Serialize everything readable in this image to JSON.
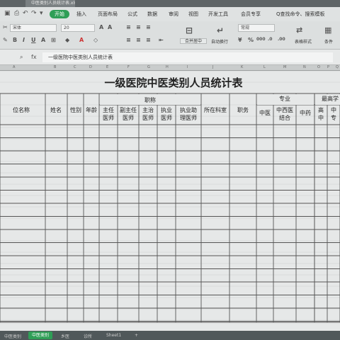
{
  "window": {
    "doc_tab": "中医类别人员统计表.xlsx"
  },
  "menu": {
    "active_tab": "开始",
    "items": [
      "插入",
      "页面布局",
      "公式",
      "数据",
      "审阅",
      "视图",
      "开发工具",
      "会员专享"
    ],
    "search": "Q查找命令、搜索模板"
  },
  "ribbon": {
    "font_name": "宋体",
    "font_size": "20",
    "number_format": "常规",
    "merge_label": "合并居中",
    "wrap_label": "自动换行",
    "format_label": "表格样式",
    "cond_label": "条件"
  },
  "formula_bar": {
    "fx": "fx",
    "formula": "一级医院中医类别人员统计表"
  },
  "columns": [
    "A",
    "B",
    "C",
    "D",
    "E",
    "F",
    "G",
    "H",
    "I",
    "J",
    "K",
    "L",
    "M",
    "N",
    "O",
    "P",
    "Q"
  ],
  "sheet": {
    "title": "一级医院中医类别人员统计表",
    "headers": {
      "unit": "位名称",
      "name": "姓名",
      "gender": "性别",
      "age": "年龄",
      "zhicheng": "职称",
      "zhuren": [
        "主任",
        "医师"
      ],
      "fuzhuren": [
        "副主任",
        "医师"
      ],
      "zhuzhi": [
        "主治",
        "医师"
      ],
      "zhiye": [
        "执业",
        "医师"
      ],
      "zhuli": [
        "执业助",
        "理医师"
      ],
      "keshi": "所在科室",
      "zhiwu": "职务",
      "zhuanye": "专业",
      "zhongyi": "中医",
      "zhongxi": [
        "中西医",
        "结合"
      ],
      "zhongyao": "中药",
      "zuigao": "最高学",
      "gaozhong": [
        "高",
        "中"
      ],
      "zhongzhuan": [
        "中",
        "专"
      ]
    }
  },
  "sheet_tabs": {
    "items": [
      "中医类别",
      "中医类别",
      "乡医",
      "诊所",
      "Sheet1",
      "+"
    ]
  }
}
